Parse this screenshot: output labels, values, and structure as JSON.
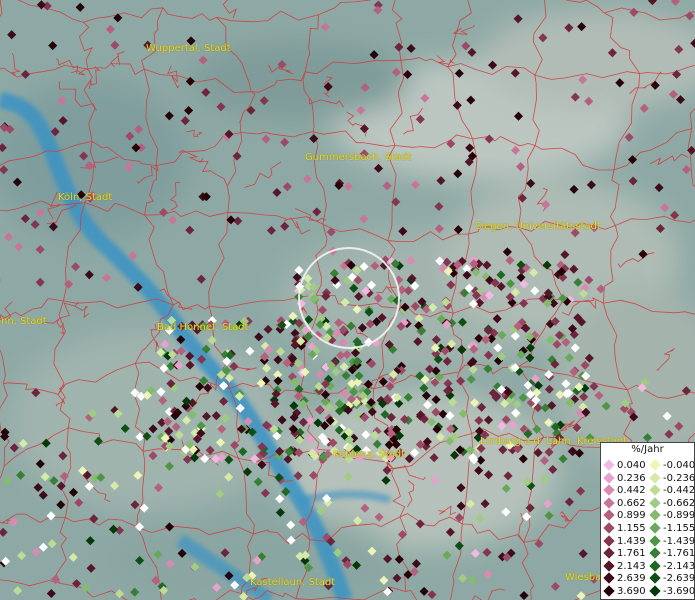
{
  "map": {
    "cities": [
      {
        "name": "Wuppertal, Stadt",
        "pos": "upper-left"
      },
      {
        "name": "Gummersbach, Stadt",
        "pos": "upper-center"
      },
      {
        "name": "Köln, Stadt",
        "pos": "left"
      },
      {
        "name": "Siegen, Universitätsstadt",
        "pos": "right"
      },
      {
        "name": "Bonn, Stadt",
        "pos": "left-edge"
      },
      {
        "name": "Bad Honnef, Stadt",
        "pos": "center-left"
      },
      {
        "name": "Koblenz, Stadt",
        "pos": "lower-center"
      },
      {
        "name": "Limburg a.d. Lahn, Kreisstadt",
        "pos": "lower-right"
      },
      {
        "name": "Kastellaun, Stadt",
        "pos": "bottom-center"
      },
      {
        "name": "Wiesbaden",
        "pos": "bottom-right"
      }
    ],
    "colors": {
      "water": "#3a93c4",
      "border": "#d23a3a",
      "label": "#e8d820"
    }
  },
  "legend": {
    "title": "%/Jahr",
    "positive": [
      "0.040",
      "0.236",
      "0.442",
      "0.662",
      "0.899",
      "1.155",
      "1.439",
      "1.761",
      "2.143",
      "2.639",
      "3.690"
    ],
    "negative": [
      "-0.040",
      "-0.236",
      "-0.442",
      "-0.662",
      "-0.899",
      "-1.155",
      "-1.439",
      "-1.761",
      "-2.143",
      "-2.639",
      "-3.690"
    ],
    "positive_colors": [
      "#f2b8e4",
      "#e8a0cc",
      "#d98ab2",
      "#c87698",
      "#b4607e",
      "#9c4a66",
      "#843650",
      "#6c253c",
      "#541628",
      "#3c0a18",
      "#240208"
    ],
    "negative_colors": [
      "#ecf5b8",
      "#d6eaa8",
      "#bcdc96",
      "#a0cc82",
      "#84bc6e",
      "#68aa5a",
      "#4e9646",
      "#368034",
      "#206824",
      "#0e5014",
      "#033808"
    ]
  }
}
